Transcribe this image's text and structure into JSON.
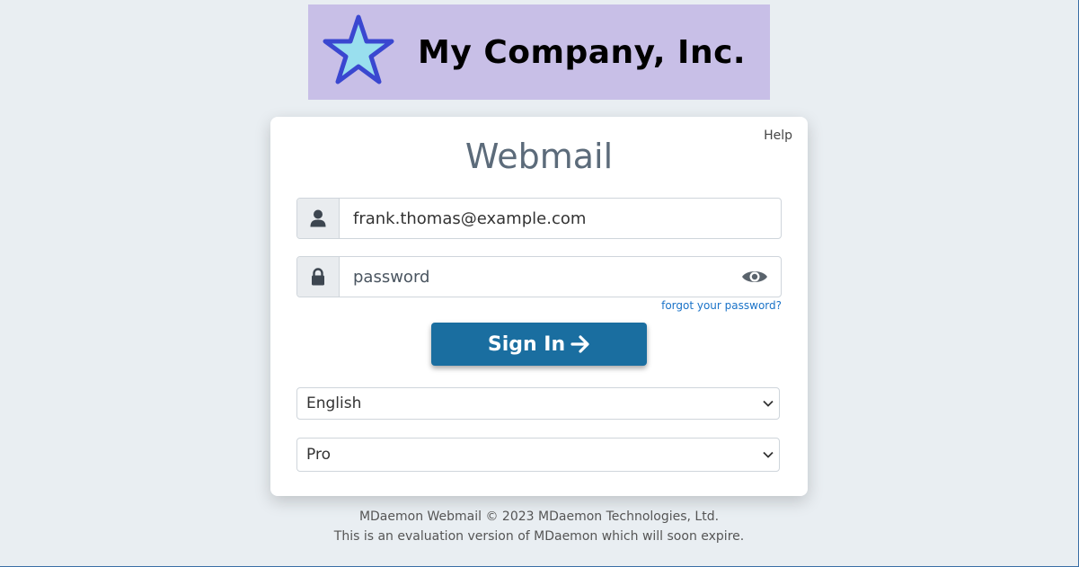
{
  "logo": {
    "text": "My Company, Inc.",
    "background": "#c8bfe7",
    "star_fill": "#99dfee",
    "star_stroke": "#3a47d0",
    "icon": "star-icon"
  },
  "card": {
    "help_label": "Help",
    "title": "Webmail"
  },
  "login": {
    "email_value": "frank.thomas@example.com",
    "password_placeholder": "password",
    "user_icon": "user-icon",
    "lock_icon": "lock-icon",
    "eye_icon": "eye-icon",
    "forgot_label": "forgot your password?",
    "signin_label": "Sign In",
    "signin_icon": "arrow-right-icon",
    "signin_color": "#1a6ea0"
  },
  "language_select": {
    "selected": "English"
  },
  "theme_select": {
    "selected": "Pro"
  },
  "footer": {
    "copyright": "MDaemon Webmail © 2023 MDaemon Technologies, Ltd.",
    "evaluation": "This is an evaluation version of MDaemon which will soon expire."
  }
}
